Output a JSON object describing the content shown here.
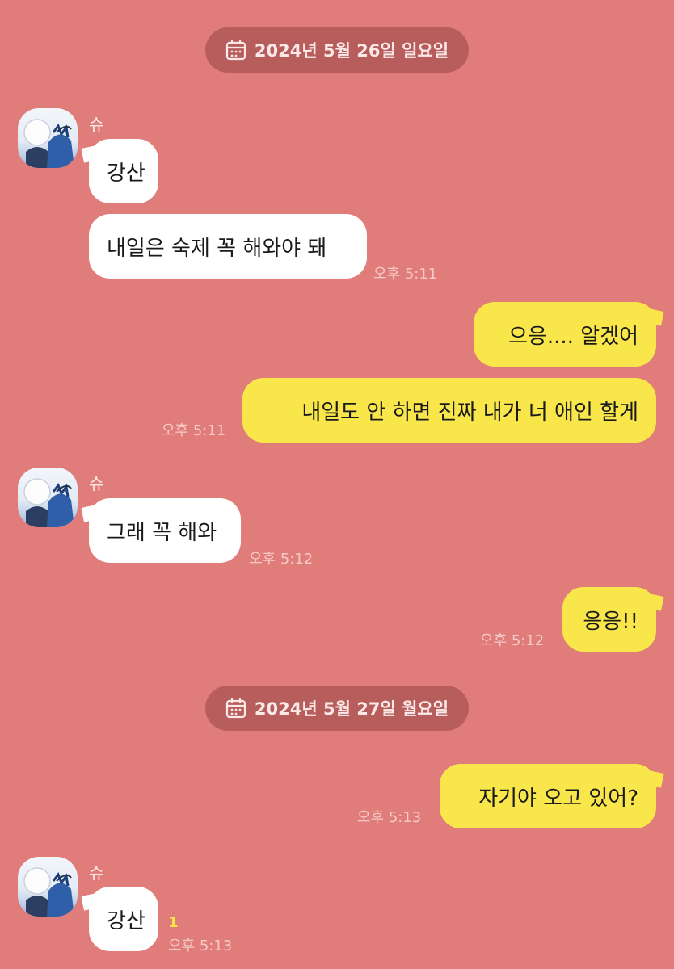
{
  "dates": [
    "2024년 5월 26일 일요일",
    "2024년 5월 27일 월요일"
  ],
  "icons": {
    "date": "calendar-icon",
    "avatar": "profile-avatar"
  },
  "colors": {
    "background": "#e07c7a",
    "incoming": "#ffffff",
    "outgoing": "#f9e64b"
  },
  "sender_name": "슈",
  "messages": [
    {
      "text": "강산"
    },
    {
      "text": "내일은 숙제 꼭 해와야 돼",
      "time": "오후 5:11"
    },
    {
      "text": "으응.... 알겠어"
    },
    {
      "text": "내일도 안 하면 진짜 내가 너 애인 할게",
      "time": "오후 5:11"
    },
    {
      "text": "그래 꼭 해와",
      "time": "오후 5:12"
    },
    {
      "text": "응응!!",
      "time": "오후 5:12"
    },
    {
      "text": "자기야 오고 있어?",
      "time": "오후 5:13"
    },
    {
      "text": "강산",
      "time": "오후 5:13",
      "unread": "1"
    }
  ]
}
